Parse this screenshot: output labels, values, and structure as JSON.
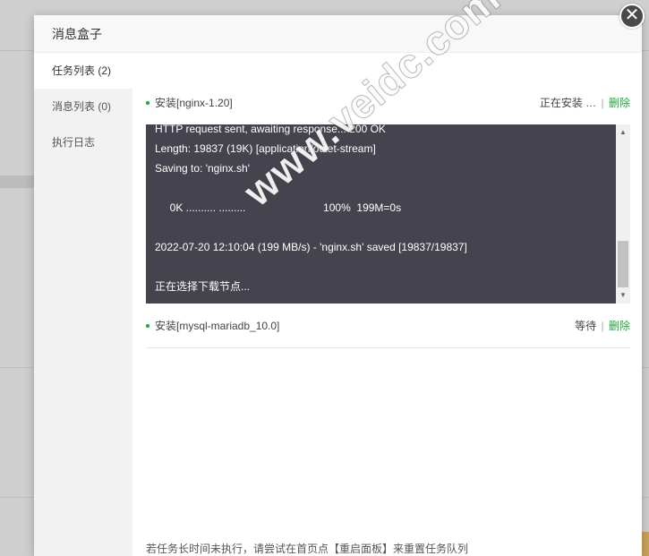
{
  "dialog": {
    "title": "消息盒子",
    "close_glyph": "✕"
  },
  "sidebar": {
    "items": [
      {
        "label": "任务列表 (2)",
        "active": true
      },
      {
        "label": "消息列表 (0)",
        "active": false
      },
      {
        "label": "执行日志",
        "active": false
      }
    ]
  },
  "tasks": [
    {
      "name": "安装[nginx-1.20]",
      "status": "正在安装 …",
      "separator": "|",
      "delete_label": "删除"
    },
    {
      "name": "安装[mysql-mariadb_10.0]",
      "status": "等待",
      "separator": "|",
      "delete_label": "删除"
    }
  ],
  "console": {
    "lines": [
      "HTTP request sent, awaiting response... 200 OK",
      "Length: 19837 (19K) [application/octet-stream]",
      "Saving to: 'nginx.sh'",
      "",
      "     0K .......... .........                          100%  199M=0s",
      "",
      "2022-07-20 12:10:04 (199 MB/s) - 'nginx.sh' saved [19837/19837]",
      "",
      "正在选择下载节点..."
    ]
  },
  "watermark": "www.veidc.com",
  "footer_note": "若任务长时间未执行，请尝试在首页点【重启面板】来重置任务队列",
  "colors": {
    "accent": "#20a53a",
    "console_bg": "#45434d"
  }
}
